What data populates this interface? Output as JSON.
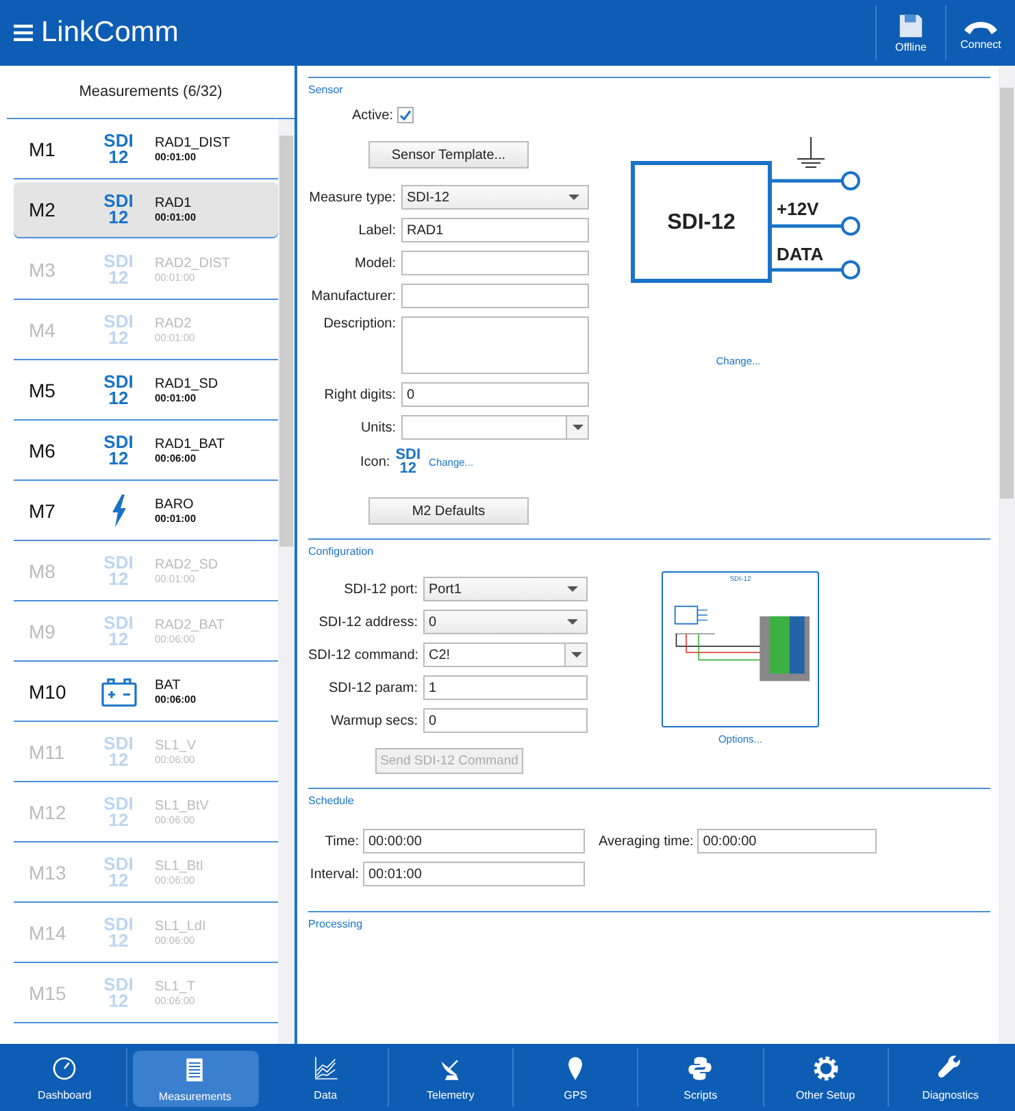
{
  "header": {
    "title": "LinkComm",
    "buttons": [
      {
        "label": "Offline",
        "kind": "floppy"
      },
      {
        "label": "Connect",
        "kind": "phone"
      }
    ]
  },
  "measurements": {
    "title": "Measurements (6/32)",
    "items": [
      {
        "id": "M1",
        "kind": "sdi",
        "icon_lines": [
          "SDI",
          "12"
        ],
        "name": "RAD1_DIST",
        "time": "00:01:00",
        "active": true,
        "selected": false
      },
      {
        "id": "M2",
        "kind": "sdi",
        "icon_lines": [
          "SDI",
          "12"
        ],
        "name": "RAD1",
        "time": "00:01:00",
        "active": true,
        "selected": true
      },
      {
        "id": "M3",
        "kind": "sdi",
        "icon_lines": [
          "SDI",
          "12"
        ],
        "name": "RAD2_DIST",
        "time": "00:01:00",
        "active": false,
        "selected": false
      },
      {
        "id": "M4",
        "kind": "sdi",
        "icon_lines": [
          "SDI",
          "12"
        ],
        "name": "RAD2",
        "time": "00:01:00",
        "active": false,
        "selected": false
      },
      {
        "id": "M5",
        "kind": "sdi",
        "icon_lines": [
          "SDI",
          "12"
        ],
        "name": "RAD1_SD",
        "time": "00:01:00",
        "active": true,
        "selected": false
      },
      {
        "id": "M6",
        "kind": "sdi",
        "icon_lines": [
          "SDI",
          "12"
        ],
        "name": "RAD1_BAT",
        "time": "00:06:00",
        "active": true,
        "selected": false
      },
      {
        "id": "M7",
        "kind": "lightning",
        "name": "BARO",
        "time": "00:01:00",
        "active": true,
        "selected": false
      },
      {
        "id": "M8",
        "kind": "sdi",
        "icon_lines": [
          "SDI",
          "12"
        ],
        "name": "RAD2_SD",
        "time": "00:01:00",
        "active": false,
        "selected": false
      },
      {
        "id": "M9",
        "kind": "sdi",
        "icon_lines": [
          "SDI",
          "12"
        ],
        "name": "RAD2_BAT",
        "time": "00:06:00",
        "active": false,
        "selected": false
      },
      {
        "id": "M10",
        "kind": "battery",
        "name": "BAT",
        "time": "00:06:00",
        "active": true,
        "selected": false
      },
      {
        "id": "M11",
        "kind": "sdi",
        "icon_lines": [
          "SDI",
          "12"
        ],
        "name": "SL1_V",
        "time": "00:06:00",
        "active": false,
        "selected": false
      },
      {
        "id": "M12",
        "kind": "sdi",
        "icon_lines": [
          "SDI",
          "12"
        ],
        "name": "SL1_BtV",
        "time": "00:06:00",
        "active": false,
        "selected": false
      },
      {
        "id": "M13",
        "kind": "sdi",
        "icon_lines": [
          "SDI",
          "12"
        ],
        "name": "SL1_BtI",
        "time": "00:06:00",
        "active": false,
        "selected": false
      },
      {
        "id": "M14",
        "kind": "sdi",
        "icon_lines": [
          "SDI",
          "12"
        ],
        "name": "SL1_LdI",
        "time": "00:06:00",
        "active": false,
        "selected": false
      },
      {
        "id": "M15",
        "kind": "sdi",
        "icon_lines": [
          "SDI",
          "12"
        ],
        "name": "SL1_T",
        "time": "00:06:00",
        "active": false,
        "selected": false
      }
    ]
  },
  "sensor": {
    "title": "Sensor",
    "active_label": "Active:",
    "active": true,
    "template_button": "Sensor Template...",
    "fields": [
      {
        "label": "Measure type:",
        "kind": "select",
        "value": "SDI-12"
      },
      {
        "label": "Label:",
        "kind": "text",
        "value": "RAD1"
      },
      {
        "label": "Model:",
        "kind": "text"
      },
      {
        "label": "Manufacturer:",
        "kind": "text"
      },
      {
        "label": "Description:",
        "kind": "textarea"
      },
      {
        "label": "Right digits:",
        "kind": "text",
        "value": "0"
      },
      {
        "label": "Units:",
        "kind": "combo"
      }
    ],
    "icon_label": "Icon:",
    "icon_lines": [
      "SDI",
      "12"
    ],
    "icon_link": "Change...",
    "defaults_button": "M2 Defaults",
    "diagram": {
      "box_label": "SDI-12",
      "pins": [
        "+12V",
        "DATA"
      ]
    },
    "diagram_link": "Change..."
  },
  "configuration": {
    "title": "Configuration",
    "fields": [
      {
        "label": "SDI-12 port:",
        "kind": "select",
        "value": "Port1"
      },
      {
        "label": "SDI-12 address:",
        "kind": "select",
        "value": "0"
      },
      {
        "label": "SDI-12 command:",
        "kind": "combo",
        "value": "C2!"
      },
      {
        "label": "SDI-12 param:",
        "kind": "text",
        "value": "1"
      },
      {
        "label": "Warmup secs:",
        "kind": "text",
        "value": "0"
      }
    ],
    "send_button": {
      "label": "Send SDI-12 Command",
      "disabled": true
    },
    "wiring": {
      "title": "SDI-12"
    },
    "options_link": "Options..."
  },
  "schedule": {
    "title": "Schedule",
    "rows": [
      [
        {
          "label": "Time:",
          "value": "00:00:00"
        },
        {
          "label": "Averaging time:",
          "value": "00:00:00"
        }
      ],
      [
        {
          "label": "Interval:",
          "value": "00:01:00"
        }
      ]
    ]
  },
  "processing": {
    "title": "Processing"
  },
  "nav": [
    {
      "label": "Dashboard",
      "kind": "gauge",
      "selected": false
    },
    {
      "label": "Measurements",
      "kind": "list",
      "selected": true
    },
    {
      "label": "Data",
      "kind": "chart",
      "selected": false
    },
    {
      "label": "Telemetry",
      "kind": "dish",
      "selected": false
    },
    {
      "label": "GPS",
      "kind": "pin",
      "selected": false
    },
    {
      "label": "Scripts",
      "kind": "python",
      "selected": false
    },
    {
      "label": "Other Setup",
      "kind": "gear",
      "selected": false
    },
    {
      "label": "Diagnostics",
      "kind": "wrench",
      "selected": false
    }
  ]
}
